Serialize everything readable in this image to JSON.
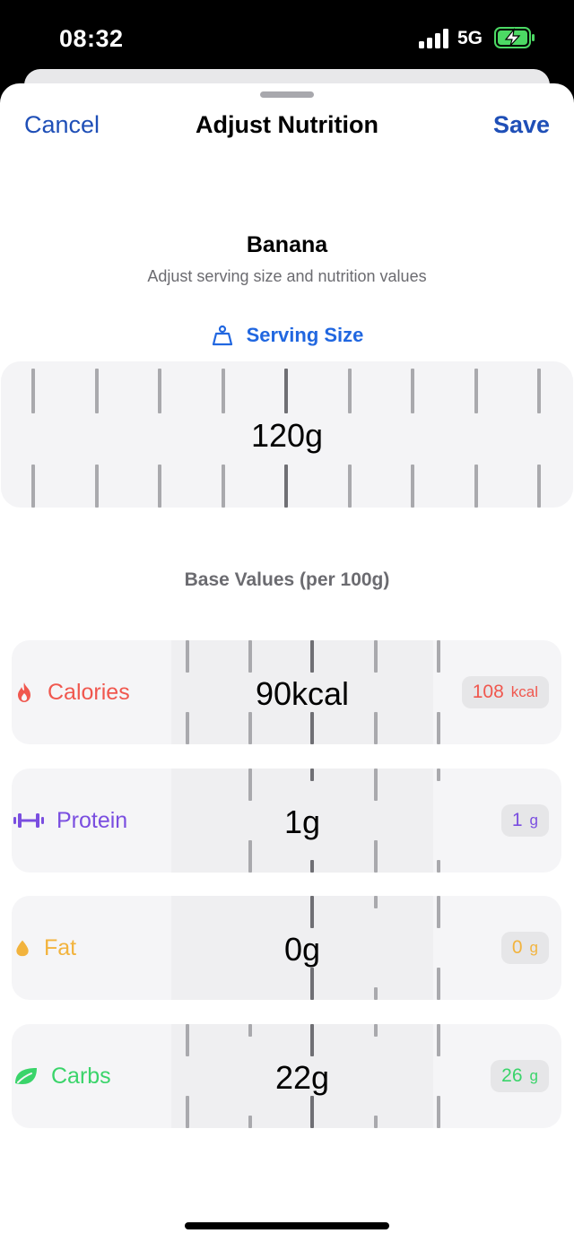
{
  "status": {
    "time": "08:32",
    "network": "5G"
  },
  "nav": {
    "cancel": "Cancel",
    "title": "Adjust Nutrition",
    "save": "Save"
  },
  "food": {
    "name": "Banana",
    "subtitle": "Adjust serving size and nutrition values"
  },
  "serving": {
    "label": "Serving Size",
    "value": "120g"
  },
  "base_values_title": "Base Values (per 100g)",
  "nutrients": [
    {
      "label": "Calories",
      "value": "90kcal",
      "computed": "108",
      "unit": "kcal",
      "color": "#f0574e",
      "icon": "flame-icon"
    },
    {
      "label": "Protein",
      "value": "1g",
      "computed": "1",
      "unit": "g",
      "color": "#7a4ee0",
      "icon": "dumbbell-icon"
    },
    {
      "label": "Fat",
      "value": "0g",
      "computed": "0",
      "unit": "g",
      "color": "#f2b33d",
      "icon": "drop-icon"
    },
    {
      "label": "Carbs",
      "value": "22g",
      "computed": "26",
      "unit": "g",
      "color": "#3ad46a",
      "icon": "leaf-icon"
    }
  ]
}
